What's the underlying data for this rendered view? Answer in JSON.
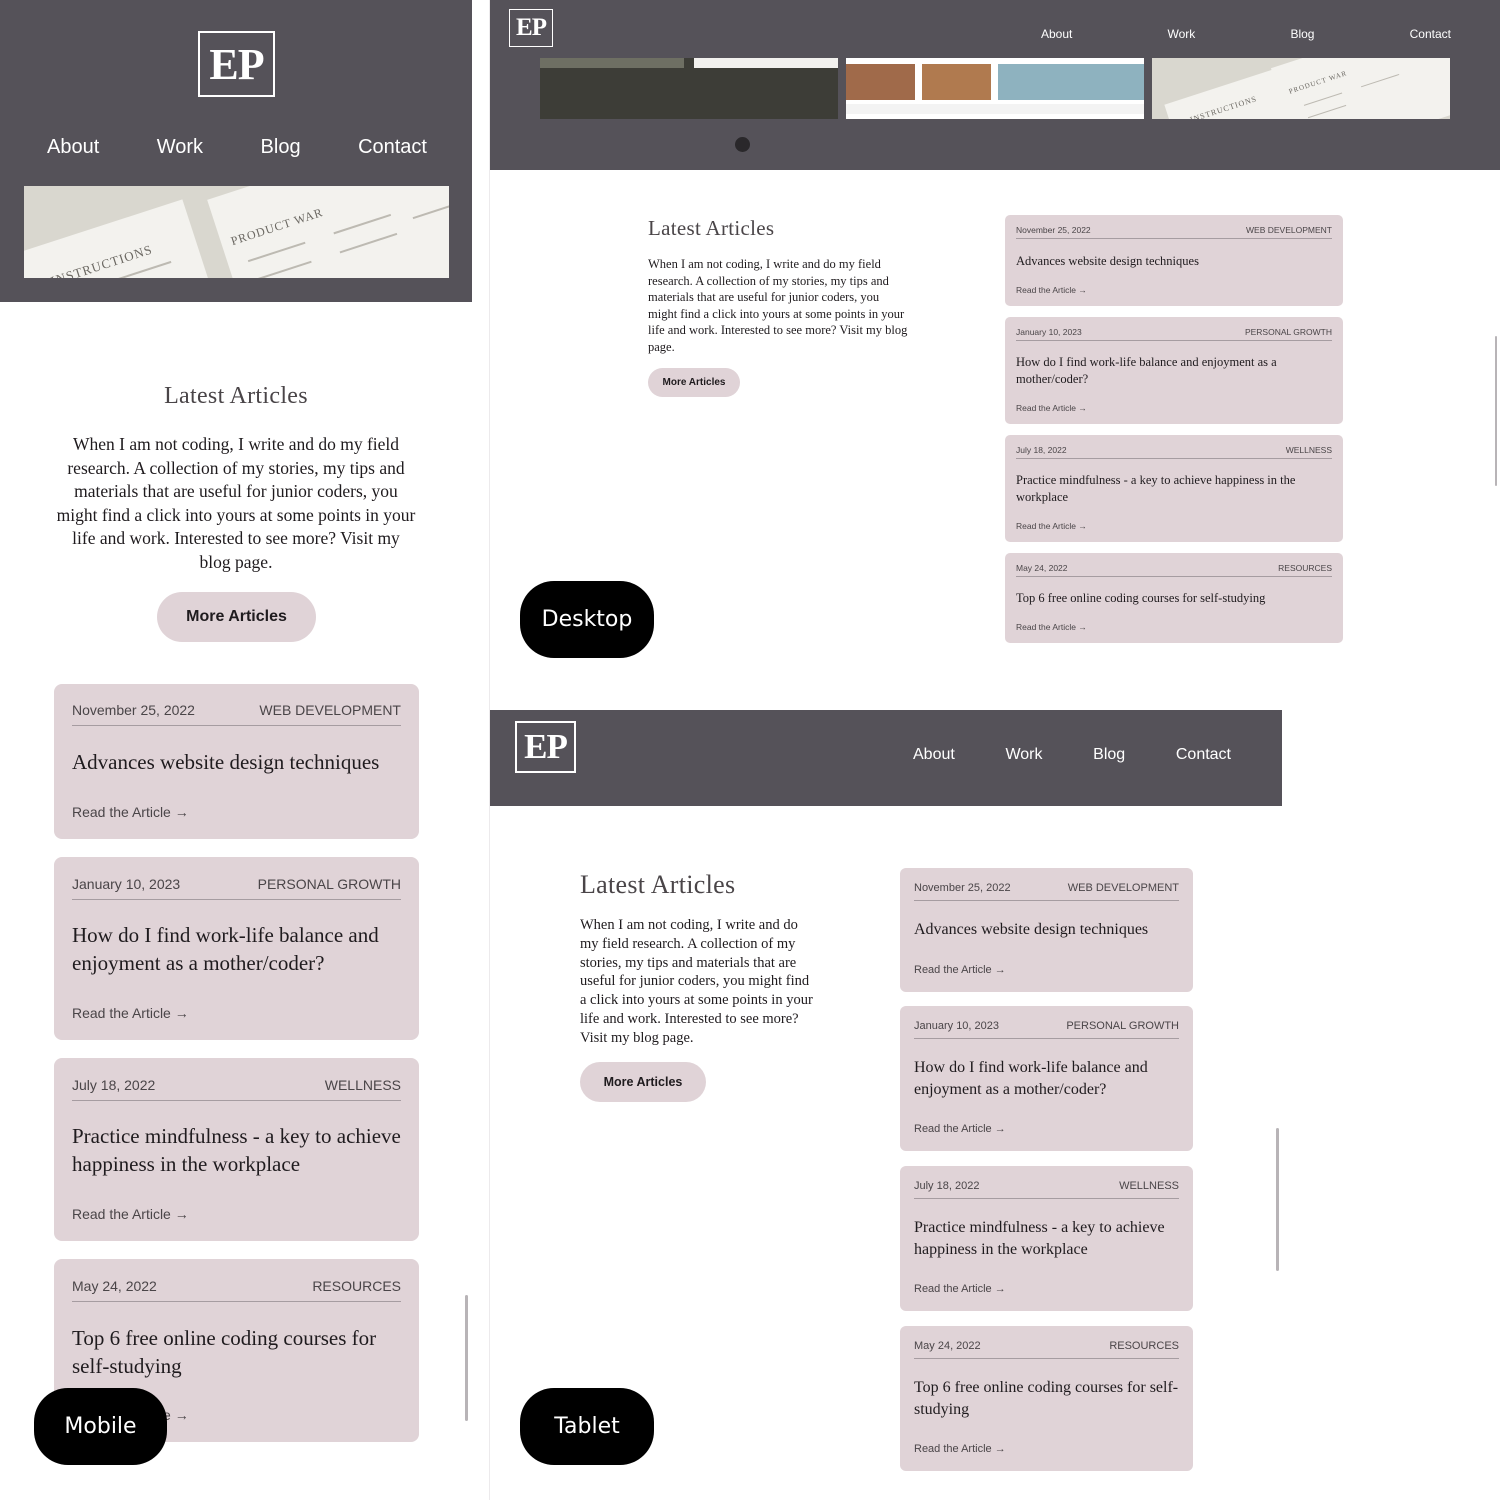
{
  "brand": {
    "logo": "EP"
  },
  "nav": [
    "About",
    "Work",
    "Blog",
    "Contact"
  ],
  "section": {
    "title": "Latest Articles",
    "intro": "When I am not coding, I write and do my field research. A collection of my stories, my tips and materials that are useful for junior coders, you might find a click into yours at some points in your life and work. Interested to see more? Visit my blog page.",
    "button": "More Articles"
  },
  "articles": [
    {
      "date": "November 25, 2022",
      "category": "WEB DEVELOPMENT",
      "title": "Advances website design techniques",
      "link": "Read the Article →"
    },
    {
      "date": "January 10, 2023",
      "category": "PERSONAL GROWTH",
      "title": "How do I find work-life balance and enjoyment as a mother/coder?",
      "link": "Read the Article →"
    },
    {
      "date": "July 18, 2022",
      "category": "WELLNESS",
      "title": "Practice mindfulness - a key to achieve happiness in the workplace",
      "link": "Read the Article →"
    },
    {
      "date": "May 24, 2022",
      "category": "RESOURCES",
      "title": "Top 6 free online coding courses for self-studying",
      "link": "Read the Article →"
    }
  ],
  "image_text": {
    "product": "PRODUCT WAR",
    "instructions": "INSTRUCTIONS"
  },
  "labels": {
    "mobile": "Mobile",
    "desktop": "Desktop",
    "tablet": "Tablet"
  },
  "colors": {
    "header": "#555259",
    "card": "#e0d3d7",
    "button": "#e0d3d7",
    "label_bg": "#000000"
  }
}
